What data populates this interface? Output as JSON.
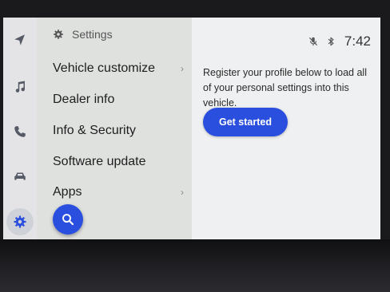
{
  "menu": {
    "title": "Settings",
    "items": [
      {
        "label": "Vehicle customize",
        "has_chevron": true
      },
      {
        "label": "Dealer info",
        "has_chevron": false
      },
      {
        "label": "Info & Security",
        "has_chevron": false
      },
      {
        "label": "Software update",
        "has_chevron": false
      },
      {
        "label": "Apps",
        "has_chevron": true
      }
    ],
    "chevron": "›"
  },
  "rail": {
    "items": [
      "navigation-icon",
      "music-icon",
      "phone-icon",
      "car-icon",
      "settings-icon"
    ],
    "active": "settings-icon"
  },
  "status": {
    "time": "7:42",
    "icons": [
      "no-mic-icon",
      "bluetooth-icon"
    ]
  },
  "content": {
    "message": "Register your profile below to load all of your personal settings into this vehicle.",
    "button_label": "Get started"
  },
  "colors": {
    "accent": "#2a4fdf",
    "rail_icon": "#555a66"
  }
}
